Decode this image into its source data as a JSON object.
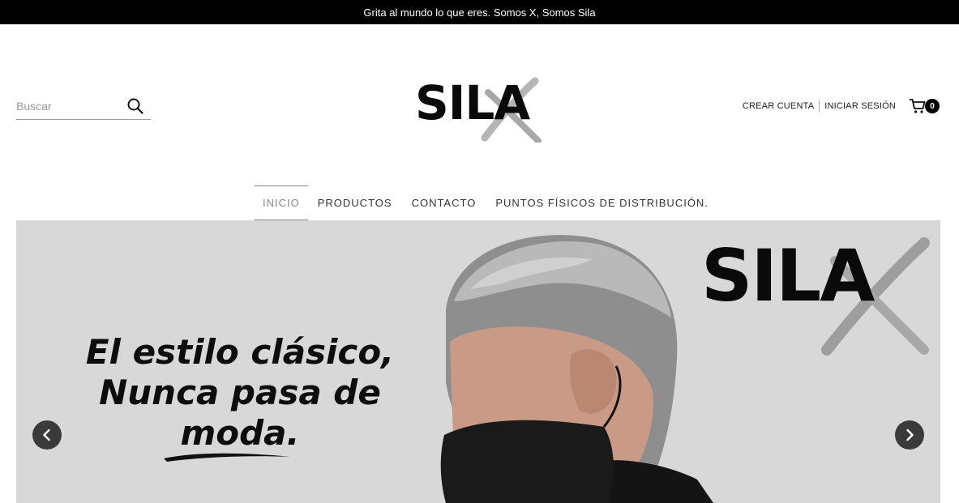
{
  "announcement": "Grita al mundo lo que eres. Somos X, Somos Sila",
  "search": {
    "placeholder": "Buscar",
    "icon": "search-icon"
  },
  "logo": {
    "text": "SILA"
  },
  "account": {
    "create_account": "CREAR CUENTA",
    "login": "INICIAR SESIÓN",
    "cart_count": "0",
    "cart_icon": "cart-icon"
  },
  "nav": {
    "items": [
      {
        "label": "INICIO"
      },
      {
        "label": "PRODUCTOS"
      },
      {
        "label": "CONTACTO"
      },
      {
        "label": "PUNTOS FÍSICOS DE DISTRIBUCIÓN."
      }
    ],
    "active_index": 0
  },
  "hero": {
    "headline_line1": "El estilo clásico,",
    "headline_line2": "Nunca pasa de",
    "headline_line3": "moda.",
    "brand": "SILA",
    "prev_icon": "chevron-left-icon",
    "next_icon": "chevron-right-icon"
  },
  "colors": {
    "topbar_bg": "#000000",
    "hero_bg": "#d8d8d8",
    "nav_active": "#888888",
    "arrow_bg": "#3a3a3a"
  }
}
